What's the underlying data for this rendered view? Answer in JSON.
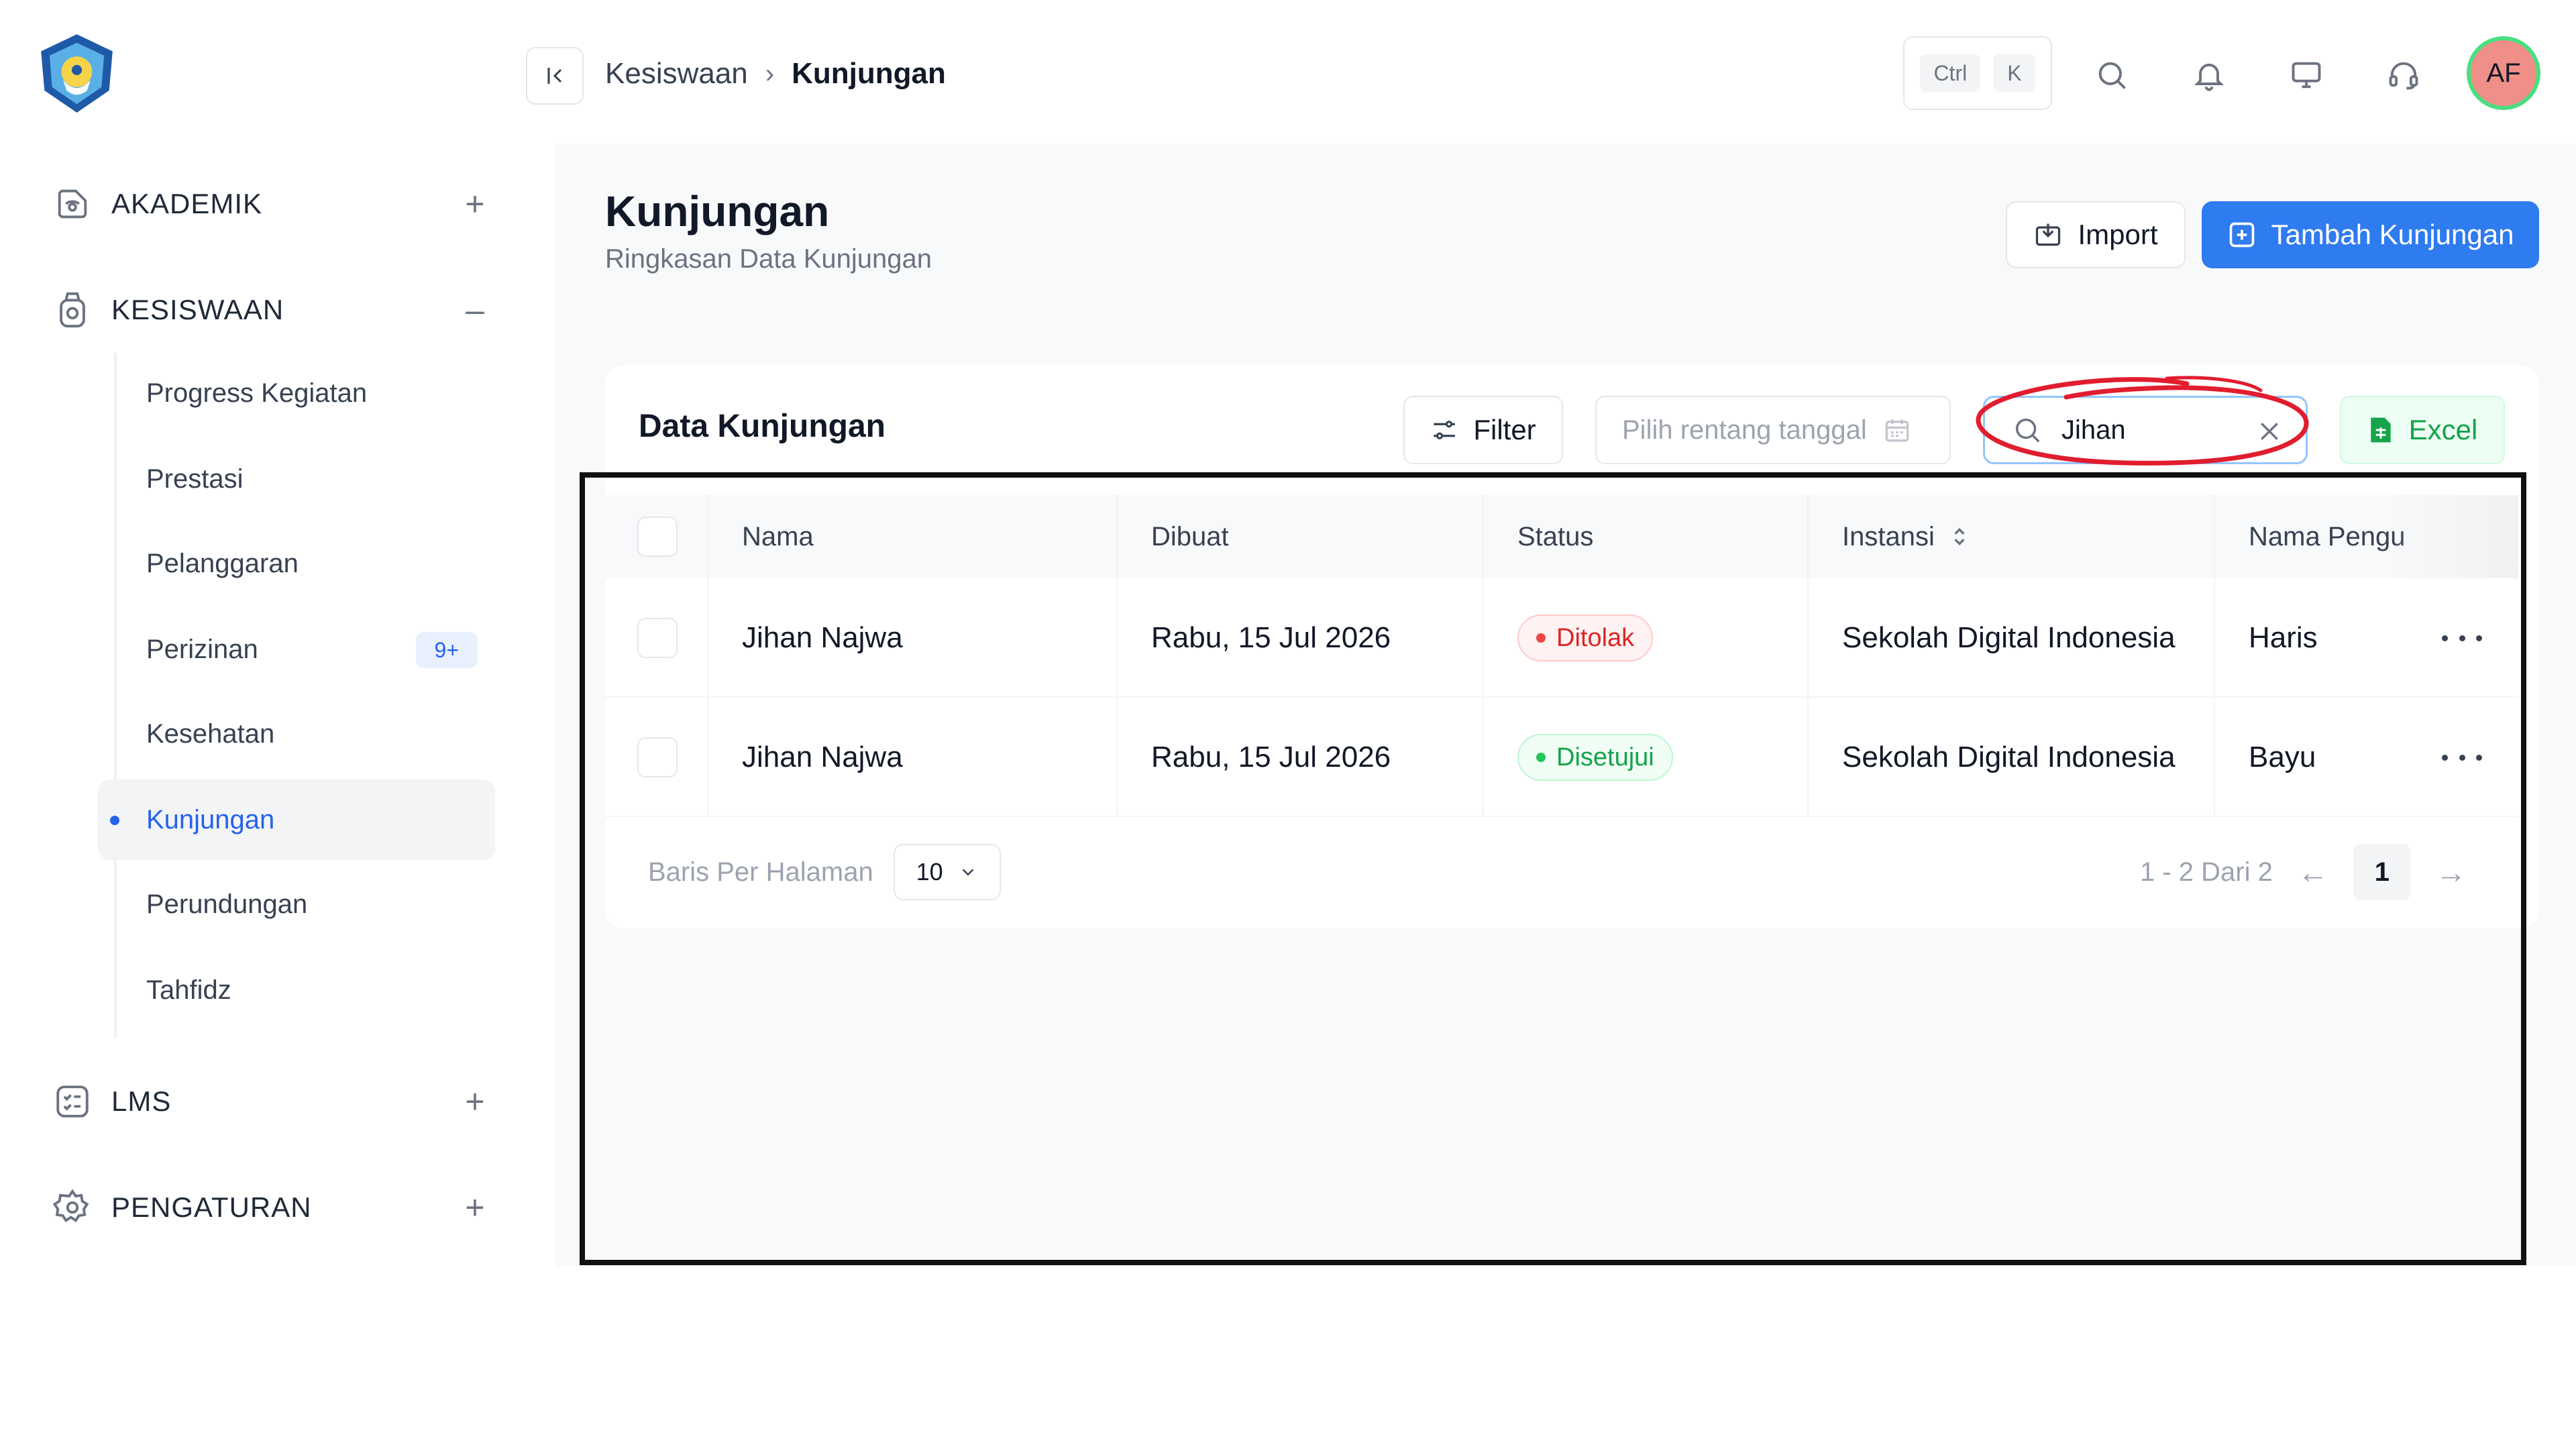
{
  "sidebar": {
    "sections": [
      {
        "label": "AKADEMIK",
        "toggle": "+"
      },
      {
        "label": "KESISWAAN",
        "toggle": "–"
      },
      {
        "label": "LMS",
        "toggle": "+"
      },
      {
        "label": "PENGATURAN",
        "toggle": "+"
      }
    ],
    "items": [
      {
        "label": "Progress Kegiatan"
      },
      {
        "label": "Prestasi"
      },
      {
        "label": "Pelanggaran"
      },
      {
        "label": "Perizinan",
        "badge": "9+"
      },
      {
        "label": "Kesehatan"
      },
      {
        "label": "Kunjungan",
        "active": true
      },
      {
        "label": "Perundungan"
      },
      {
        "label": "Tahfidz"
      }
    ]
  },
  "header": {
    "breadcrumb": [
      "Kesiswaan",
      "Kunjungan"
    ],
    "shortcut": [
      "Ctrl",
      "K"
    ],
    "avatar": "AF"
  },
  "page": {
    "title": "Kunjungan",
    "subtitle": "Ringkasan Data Kunjungan",
    "import_label": "Import",
    "add_label": "Tambah Kunjungan"
  },
  "card": {
    "title": "Data Kunjungan",
    "filter_label": "Filter",
    "date_placeholder": "Pilih rentang tanggal",
    "search_value": "Jihan",
    "excel_label": "Excel"
  },
  "table": {
    "columns": [
      "Nama",
      "Dibuat",
      "Status",
      "Instansi",
      "Nama Pengu"
    ],
    "rows": [
      {
        "nama": "Jihan Najwa",
        "dibuat": "Rabu, 15 Jul 2026",
        "status": "Ditolak",
        "instansi": "Sekolah Digital Indonesia",
        "pengunjung": "Haris"
      },
      {
        "nama": "Jihan Najwa",
        "dibuat": "Rabu, 15 Jul 2026",
        "status": "Disetujui",
        "instansi": "Sekolah Digital Indonesia",
        "pengunjung": "Bayu"
      }
    ]
  },
  "pagination": {
    "rows_label": "Baris Per Halaman",
    "page_size": "10",
    "range": "1 - 2 Dari 2",
    "current": "1"
  },
  "colors": {
    "primary": "#2f7bf0",
    "rejected": "#dc2626",
    "approved": "#16a34a",
    "annotation_ellipse": "#e11d2e",
    "annotation_frame": "#111111"
  }
}
